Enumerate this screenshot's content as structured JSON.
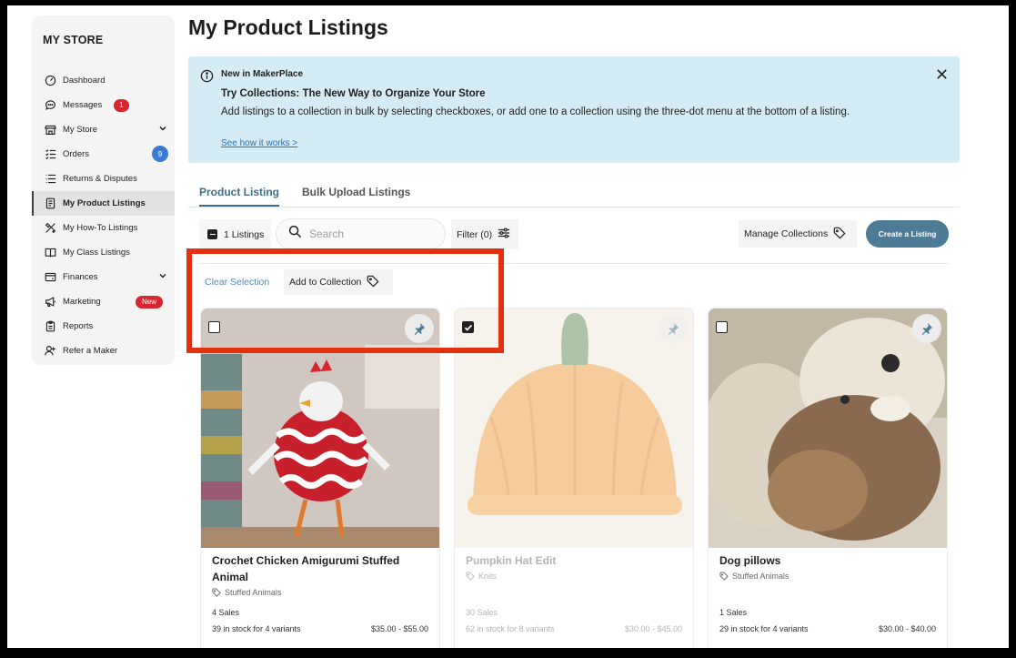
{
  "sidebar": {
    "title": "MY STORE",
    "items": [
      {
        "label": "Dashboard",
        "icon": "gauge-icon"
      },
      {
        "label": "Messages",
        "icon": "chat-icon",
        "badge": "1"
      },
      {
        "label": "My Store",
        "icon": "storefront-icon"
      },
      {
        "label": "Orders",
        "icon": "list-check-icon",
        "badge": "9"
      },
      {
        "label": "Returns & Disputes",
        "icon": "list-icon"
      },
      {
        "label": "My Product Listings",
        "icon": "document-icon",
        "active": true
      },
      {
        "label": "My How-To Listings",
        "icon": "tools-icon"
      },
      {
        "label": "My Class Listings",
        "icon": "book-icon"
      },
      {
        "label": "Finances",
        "icon": "wallet-icon"
      },
      {
        "label": "Marketing",
        "icon": "megaphone-icon",
        "badge": "New"
      },
      {
        "label": "Reports",
        "icon": "clipboard-icon"
      },
      {
        "label": "Refer a Maker",
        "icon": "add-user-icon"
      }
    ]
  },
  "page_title": "My Product Listings",
  "banner": {
    "kicker": "New in MakerPlace",
    "heading": "Try Collections: The New Way to Organize Your Store",
    "body": "Add listings to a collection in bulk by selecting checkboxes, or add one to a collection using the three-dot menu at the bottom of a listing.",
    "link": "See how it works >"
  },
  "tabs": [
    "Product Listing",
    "Bulk Upload Listings"
  ],
  "toolbar": {
    "selection": "1 Listings",
    "search_placeholder": "Search",
    "filter": "Filter (0)",
    "manage_collections": "Manage Collections",
    "create_listing": "Create a Listing"
  },
  "bulk": {
    "clear_selection": "Clear Selection",
    "add_to_collection": "Add to Collection"
  },
  "listings": [
    {
      "name": "Crochet Chicken Amigurumi Stuffed Animal",
      "category": "Stuffed Animals",
      "sales": "4 Sales",
      "stock": "39 in stock for 4 variants",
      "price": "$35.00 - $55.00",
      "checked": false
    },
    {
      "name": "Pumpkin Hat Edit",
      "category": "Knits",
      "sales": "30 Sales",
      "stock": "62 in stock for 8 variants",
      "price": "$30.00 - $45.00",
      "checked": true
    },
    {
      "name": "Dog pillows",
      "category": "Stuffed Animals",
      "sales": "1 Sales",
      "stock": "29 in stock for 4 variants",
      "price": "$30.00 - $40.00",
      "checked": false
    }
  ],
  "colors": {
    "accent": "#4d7a94",
    "banner": "#d5ecf4",
    "highlight": "#e3300f",
    "badge_red": "#d8262f",
    "badge_blue": "#3a7bd5"
  }
}
